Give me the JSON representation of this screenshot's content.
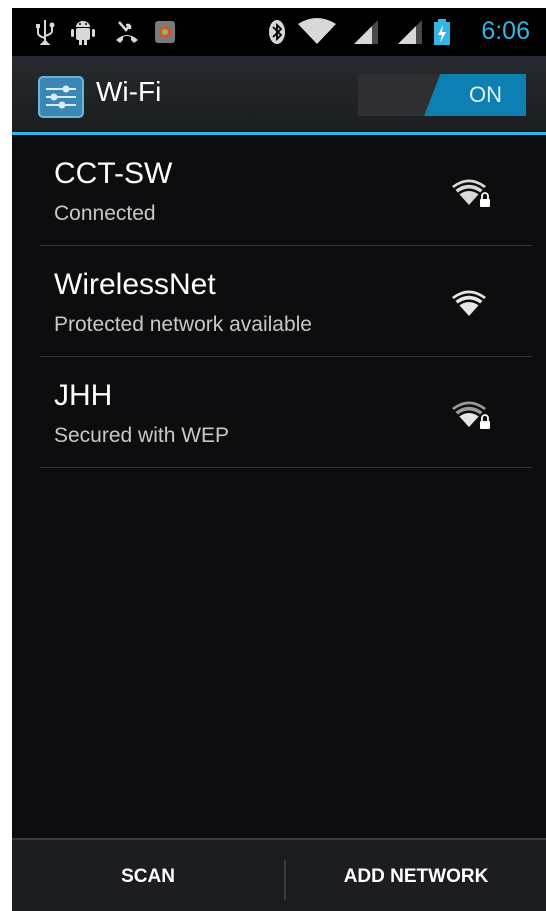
{
  "status_bar": {
    "time": "6:06",
    "icons": [
      "usb-icon",
      "android-debug-icon",
      "missed-call-icon",
      "app-notification-icon",
      "bluetooth-icon",
      "wifi-signal-icon",
      "cell-signal-icon",
      "cell-signal-icon",
      "battery-charging-icon"
    ],
    "accent_color": "#33b5e5"
  },
  "action_bar": {
    "title": "Wi-Fi",
    "icon": "settings-sliders-icon",
    "toggle_label": "ON",
    "toggle_state": true
  },
  "networks": [
    {
      "ssid": "CCT-SW",
      "status": "Connected",
      "secured": true
    },
    {
      "ssid": "WirelessNet",
      "status": "Protected network available",
      "secured": false
    },
    {
      "ssid": "JHH",
      "status": "Secured with WEP",
      "secured": true
    }
  ],
  "bottom_bar": {
    "scan_label": "SCAN",
    "add_network_label": "ADD NETWORK"
  }
}
